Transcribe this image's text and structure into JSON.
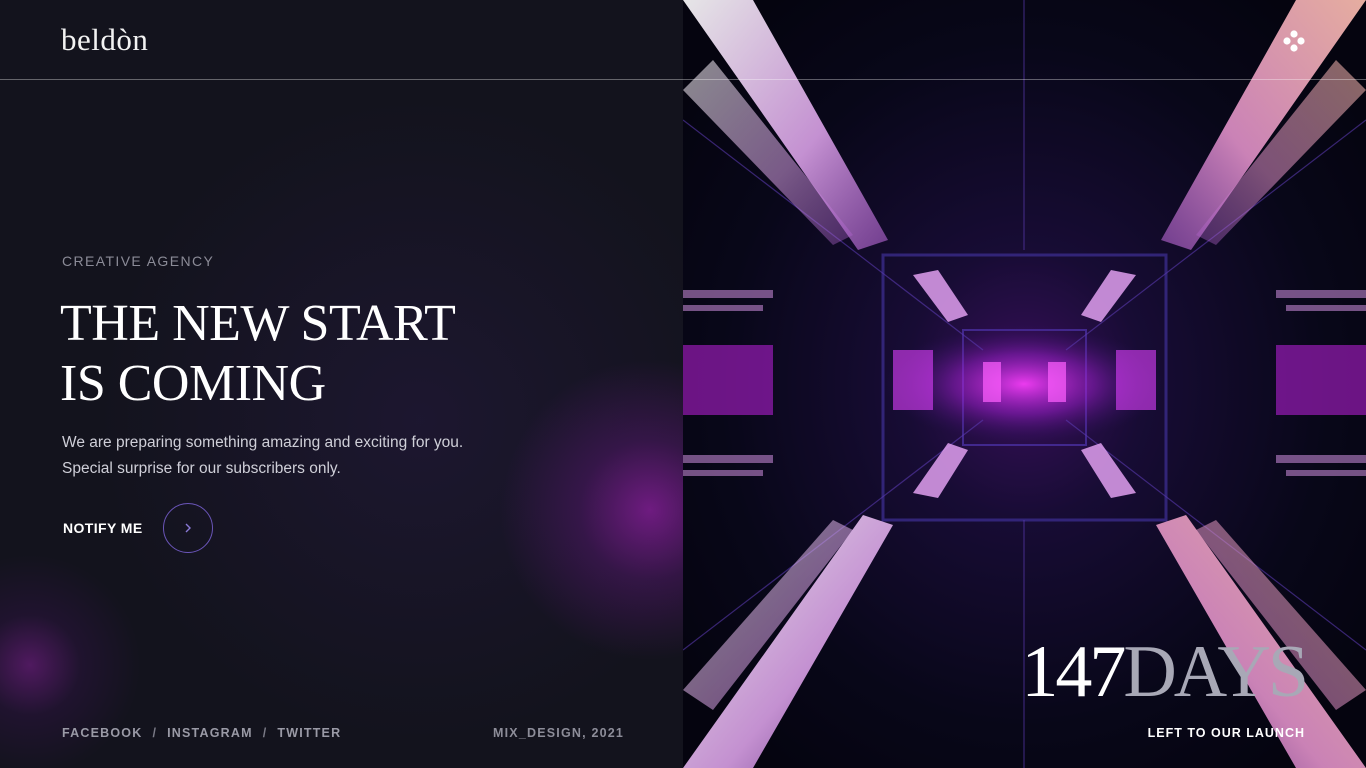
{
  "brand": {
    "logo": "beldòn"
  },
  "header": {
    "menu_icon": "dots-grid-icon"
  },
  "hero": {
    "eyebrow": "CREATIVE AGENCY",
    "title_line1": "THE NEW START",
    "title_line2": "IS COMING",
    "desc_line1": "We are preparing something amazing and exciting for you.",
    "desc_line2": "Special surprise for our subscribers only.",
    "notify_label": "NOTIFY ME",
    "notify_icon": "chevron-right-icon"
  },
  "footer": {
    "social": [
      "FACEBOOK",
      "INSTAGRAM",
      "TWITTER"
    ],
    "separator": "/",
    "credit": "MIX_DESIGN, 2021"
  },
  "countdown": {
    "number": "147",
    "unit": "DAYS",
    "caption": "LEFT TO OUR LAUNCH"
  },
  "colors": {
    "background": "#13131d",
    "accent_purple": "#6a55b8",
    "glow_magenta": "#8c1ea0"
  }
}
